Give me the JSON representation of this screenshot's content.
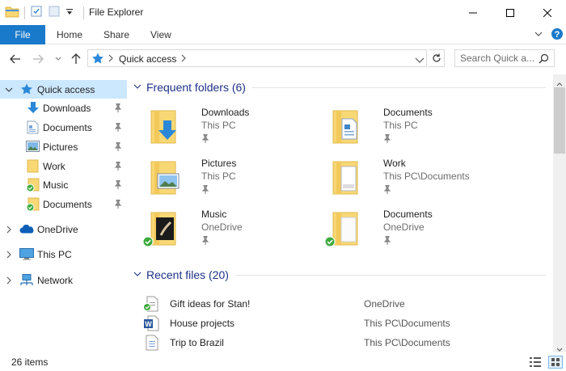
{
  "window": {
    "title": "File Explorer"
  },
  "ribbon": {
    "tabs": [
      {
        "label": "File"
      },
      {
        "label": "Home"
      },
      {
        "label": "Share"
      },
      {
        "label": "View"
      }
    ]
  },
  "address": {
    "path": [
      "Quick access"
    ],
    "search_placeholder": "Search Quick a..."
  },
  "nav": {
    "items": [
      {
        "label": "Quick access",
        "icon": "star-icon",
        "selected": true
      },
      {
        "label": "Downloads",
        "icon": "download-arrow-icon",
        "pinned": true
      },
      {
        "label": "Documents",
        "icon": "document-icon",
        "pinned": true
      },
      {
        "label": "Pictures",
        "icon": "pictures-icon",
        "pinned": true
      },
      {
        "label": "Work",
        "icon": "folder-icon",
        "pinned": true
      },
      {
        "label": "Music",
        "icon": "synced-folder-icon",
        "pinned": true
      },
      {
        "label": "Documents",
        "icon": "synced-folder-icon",
        "pinned": true
      },
      {
        "label": "OneDrive",
        "icon": "cloud-icon"
      },
      {
        "label": "This PC",
        "icon": "monitor-icon"
      },
      {
        "label": "Network",
        "icon": "network-icon"
      }
    ]
  },
  "frequent": {
    "title": "Frequent folders (6)",
    "folders": [
      {
        "name": "Downloads",
        "location": "This PC",
        "icon": "downloads-folder-icon"
      },
      {
        "name": "Documents",
        "location": "This PC",
        "icon": "documents-folder-icon"
      },
      {
        "name": "Pictures",
        "location": "This PC",
        "icon": "pictures-folder-icon"
      },
      {
        "name": "Work",
        "location": "This PC\\Documents",
        "icon": "work-folder-icon"
      },
      {
        "name": "Music",
        "location": "OneDrive",
        "icon": "music-folder-icon",
        "synced": true
      },
      {
        "name": "Documents",
        "location": "OneDrive",
        "icon": "onedrive-documents-folder-icon",
        "synced": true
      }
    ]
  },
  "recent": {
    "title": "Recent files (20)",
    "files": [
      {
        "name": "Gift ideas for Stan!",
        "location": "OneDrive",
        "icon": "synced-document-icon"
      },
      {
        "name": "House projects",
        "location": "This PC\\Documents",
        "icon": "word-document-icon"
      },
      {
        "name": "Trip to Brazil",
        "location": "This PC\\Documents",
        "icon": "text-document-icon"
      }
    ]
  },
  "status": {
    "count": "26 items"
  },
  "colors": {
    "accent": "#1979ca",
    "selection": "#cce8ff",
    "group_header": "#1e3287",
    "folder": "#f8d775",
    "sync_green": "#3dab3d"
  }
}
